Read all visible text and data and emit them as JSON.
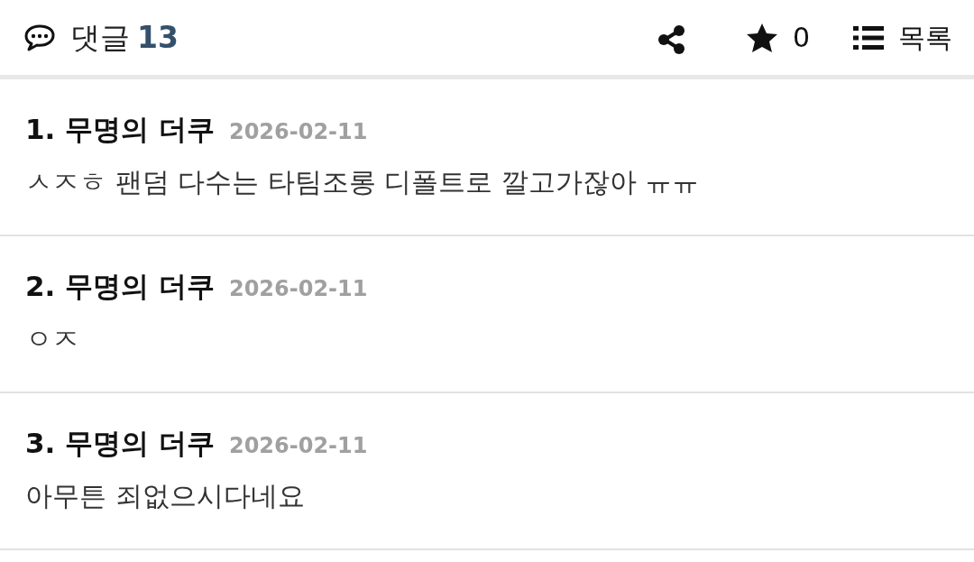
{
  "header": {
    "title": "댓글",
    "count": "13",
    "likes": "0",
    "list_label": "목록"
  },
  "comments": [
    {
      "number": "1.",
      "author": "무명의 더쿠",
      "date": "2026-02-11",
      "text": "ㅅㅈㅎ 팬덤 다수는 타팀조롱 디폴트로 깔고가잖아 ㅠㅠ"
    },
    {
      "number": "2.",
      "author": "무명의 더쿠",
      "date": "2026-02-11",
      "text": "ㅇㅈ"
    },
    {
      "number": "3.",
      "author": "무명의 더쿠",
      "date": "2026-02-11",
      "text": "아무튼 죄없으시다네요"
    }
  ]
}
